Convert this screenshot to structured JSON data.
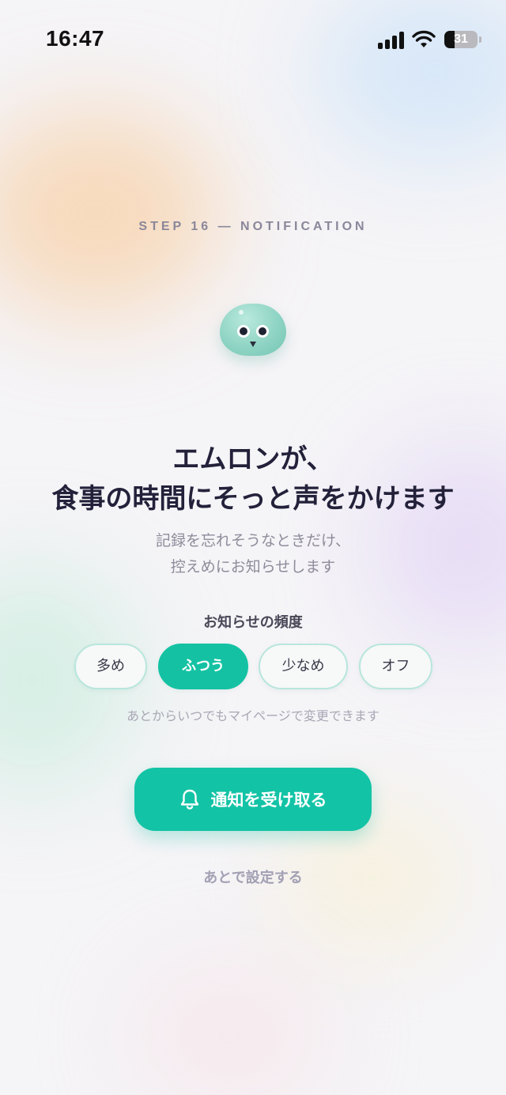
{
  "status_bar": {
    "time": "16:47",
    "battery_level": "31",
    "icons": [
      "cellular-signal-icon",
      "wifi-icon",
      "battery-icon"
    ]
  },
  "step_label": "STEP 16 — NOTIFICATION",
  "mascot": {
    "icon": "mascot-bird-icon"
  },
  "headline": {
    "line1": "エムロンが、",
    "line2": "食事の時間にそっと声をかけます"
  },
  "subtext": {
    "line1": "記録を忘れそうなときだけ、",
    "line2": "控えめにお知らせします"
  },
  "frequency": {
    "label": "お知らせの頻度",
    "options": [
      "多め",
      "ふつう",
      "少なめ",
      "オフ"
    ],
    "selected": "ふつう",
    "note": "あとからいつでもマイページで変更できます"
  },
  "primary_button": {
    "label": "通知を受け取る",
    "icon": "bell-icon"
  },
  "secondary_link": {
    "label": "あとで設定する"
  },
  "colors": {
    "accent": "#13c3a6",
    "headline": "#23213a",
    "option_border": "#b8e6dc"
  }
}
